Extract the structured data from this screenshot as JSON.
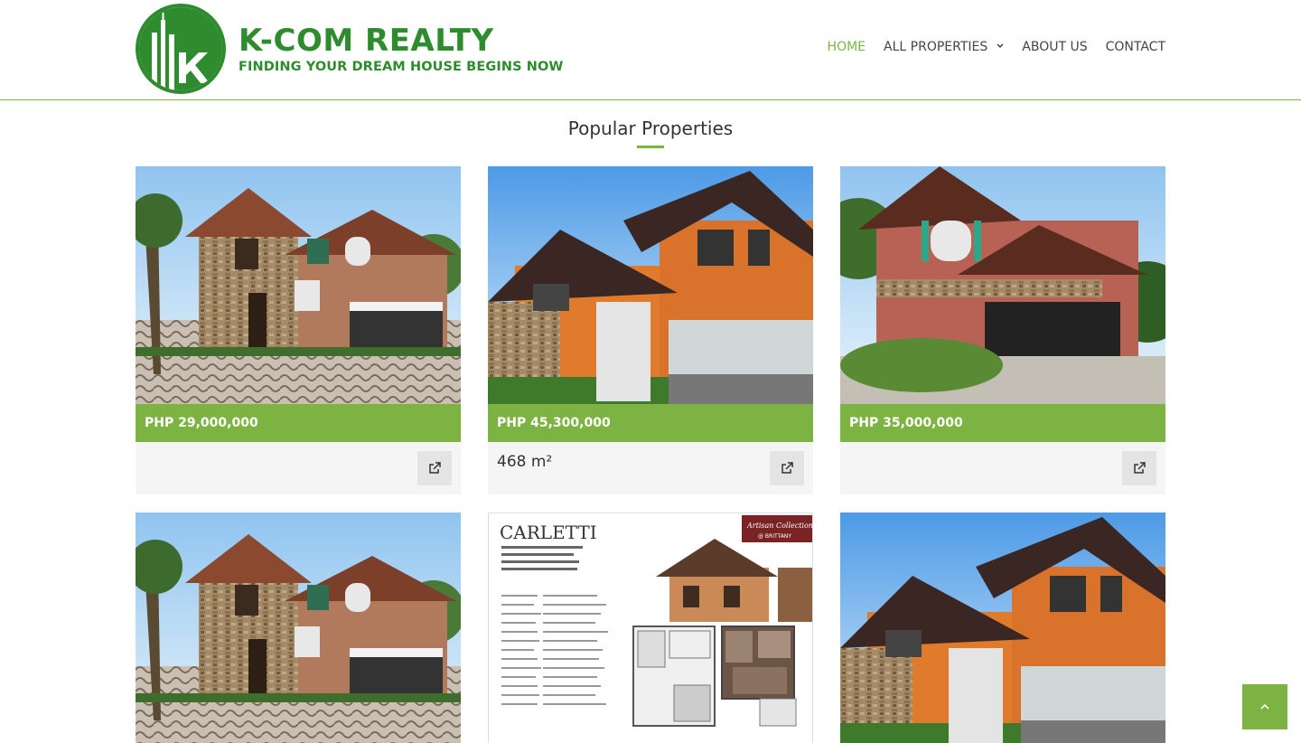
{
  "brand": {
    "title": "K-COM REALTY",
    "tagline": "FINDING YOUR DREAM HOUSE BEGINS NOW",
    "logo_letter": "k",
    "color": "#2e8b2e"
  },
  "nav": {
    "items": [
      {
        "label": "HOME",
        "active": true
      },
      {
        "label": "ALL PROPERTIES",
        "has_dropdown": true
      },
      {
        "label": "ABOUT US"
      },
      {
        "label": "CONTACT"
      }
    ]
  },
  "section": {
    "title": "Popular Properties"
  },
  "cards": [
    {
      "price": "PHP 29,000,000",
      "area": "",
      "image": "stone-villa"
    },
    {
      "price": "PHP 45,300,000",
      "area": "468 m²",
      "image": "orange-house"
    },
    {
      "price": "PHP 35,000,000",
      "area": "",
      "image": "red-house"
    },
    {
      "image": "stone-villa"
    },
    {
      "image": "floor-plan",
      "plan_title": "CARLETTI",
      "plan_badge": "Artisan Collection\n@ BRITTANY"
    },
    {
      "image": "orange-house"
    }
  ],
  "icons": {
    "external_link": "external-link-icon",
    "scroll_top": "chevron-up-icon",
    "dropdown": "chevron-down-icon"
  },
  "colors": {
    "accent": "#7cb342",
    "price_bar_text": "#ffffff"
  }
}
